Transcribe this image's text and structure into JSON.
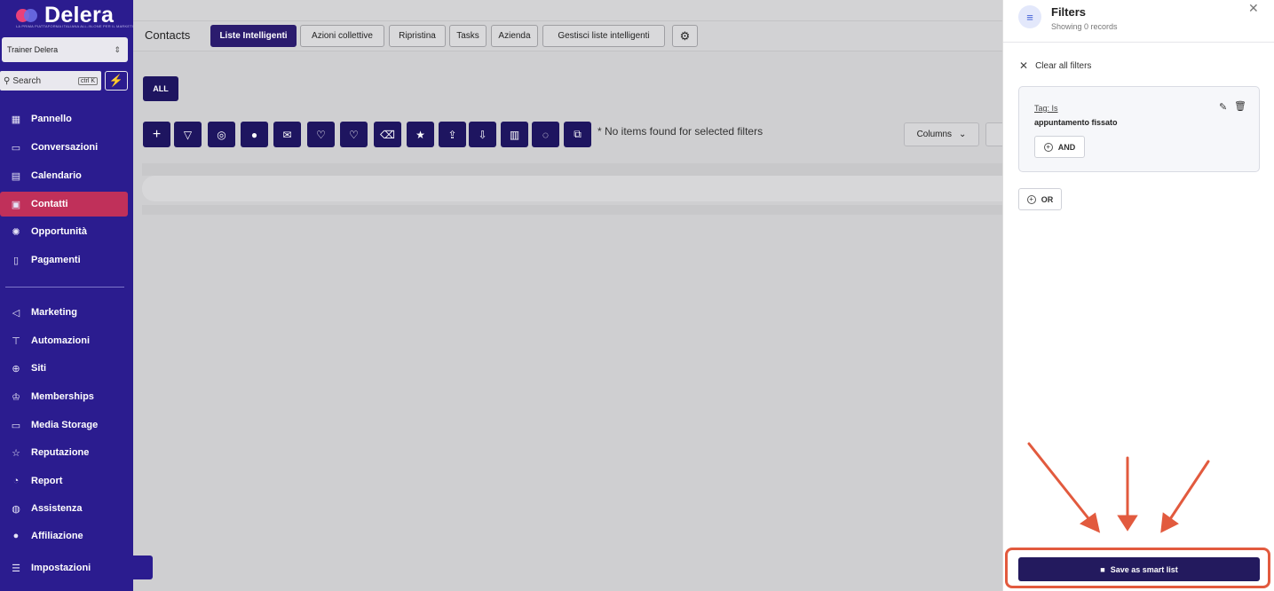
{
  "brand": {
    "name": "Delera",
    "tagline": "LA PRIMA PIATTAFORMA ITALIANA ALL-IN-ONE PER IL MARKETING"
  },
  "account": {
    "name": "Trainer Delera"
  },
  "search": {
    "label": "Search",
    "shortcut": "ctrl K"
  },
  "sidebar": {
    "items": [
      {
        "label": "Pannello",
        "icon": "dashboard-icon"
      },
      {
        "label": "Conversazioni",
        "icon": "chat-icon"
      },
      {
        "label": "Calendario",
        "icon": "calendar-icon"
      },
      {
        "label": "Contatti",
        "icon": "contacts-icon",
        "active": true
      },
      {
        "label": "Opportunità",
        "icon": "lightbulb-icon"
      },
      {
        "label": "Pagamenti",
        "icon": "payments-icon"
      },
      {
        "label": "Marketing",
        "icon": "megaphone-icon"
      },
      {
        "label": "Automazioni",
        "icon": "workflow-icon"
      },
      {
        "label": "Siti",
        "icon": "globe-icon"
      },
      {
        "label": "Memberships",
        "icon": "crown-icon"
      },
      {
        "label": "Media Storage",
        "icon": "storage-icon"
      },
      {
        "label": "Reputazione",
        "icon": "star-icon"
      },
      {
        "label": "Report",
        "icon": "chart-icon"
      },
      {
        "label": "Assistenza",
        "icon": "headset-icon"
      },
      {
        "label": "Affiliazione",
        "icon": "user-plus-icon"
      },
      {
        "label": "Impostazioni",
        "icon": "settings-icon"
      }
    ]
  },
  "main": {
    "title": "Contacts",
    "tabs": [
      {
        "label": "Liste Intelligenti",
        "active": true
      },
      {
        "label": "Azioni collettive"
      },
      {
        "label": "Ripristina"
      },
      {
        "label": "Tasks"
      },
      {
        "label": "Azienda"
      },
      {
        "label": "Gestisci liste intelligenti"
      }
    ],
    "all_label": "ALL",
    "no_items": "* No items found for selected filters",
    "columns_label": "Columns"
  },
  "filters": {
    "title": "Filters",
    "subtitle": "Showing 0 records",
    "clear_all": "Clear all filters",
    "condition_label": "Tag: Is",
    "condition_value": "appuntamento fissato",
    "and_label": "AND",
    "or_label": "OR",
    "save_label": "Save as smart list"
  },
  "colors": {
    "sidebar": "#2b1c8f",
    "active_nav": "#c0305a",
    "primary_button": "#231a5e",
    "annotation": "#e25a3e"
  }
}
